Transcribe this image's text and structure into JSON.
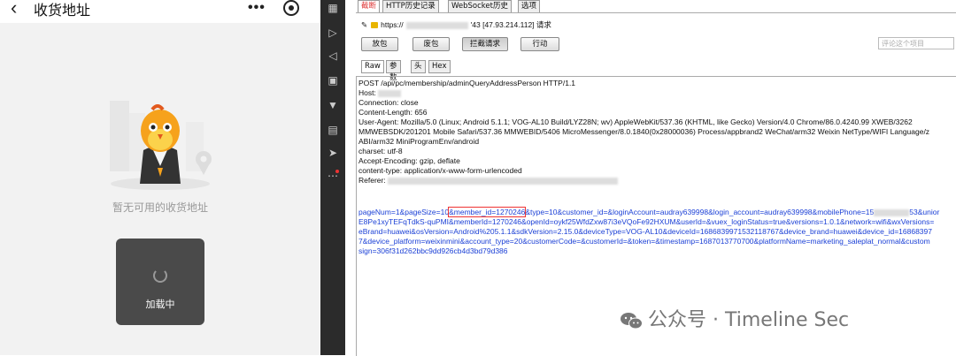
{
  "miniprogram": {
    "back_icon": "chevron-left-icon",
    "title": "收货地址",
    "more_dots": "•••",
    "empty_text": "暂无可用的收货地址",
    "loading_label": "加载中"
  },
  "burp": {
    "tabs": [
      "截断",
      "HTTP历史记录",
      "WebSocket历史",
      "选项"
    ],
    "url": {
      "prefix": "https://",
      "suffix": "'43  [47.93.214.112] 请求"
    },
    "buttons": {
      "forward": "放包",
      "drop": "废包",
      "intercept": "拦截请求",
      "action": "行动"
    },
    "search_placeholder": "评论这个项目",
    "subtabs": [
      "Raw",
      "参数",
      "头",
      "Hex"
    ],
    "request": {
      "request_line": "POST /api/pc/membership/adminQueryAddressPerson HTTP/1.1",
      "host_label": "Host:",
      "connection": "Connection: close",
      "content_length": "Content-Length: 656",
      "ua_1": "User-Agent: Mozilla/5.0 (Linux; Android 5.1.1; VOG-AL10 Build/LYZ28N; wv) AppleWebKit/537.36 (KHTML, like Gecko) Version/4.0 Chrome/86.0.4240.99 XWEB/3262",
      "ua_2": "MMWEBSDK/201201 Mobile Safari/537.36 MMWEBID/5406 MicroMessenger/8.0.1840(0x28000036) Process/appbrand2 WeChat/arm32 Weixin NetType/WIFI Language/z",
      "ua_3": "ABI/arm32 MiniProgramEnv/android",
      "charset": "charset: utf-8",
      "accept_encoding": "Accept-Encoding: gzip, deflate",
      "content_type": "content-type: application/x-www-form-urlencoded",
      "referer_label": "Referer:",
      "body_1a": "pageNum=1&pageSize=10",
      "body_1_hl": "&member_id=1270246",
      "body_1b": "&type=10&customer_id=&loginAccount=audray639998&login_account=audray639998&mobilePhone=15",
      "body_1c": "53&unior",
      "body_2": "E8Pe1xyTEFqTdkS-quPMI&memberId=1270246&openId=oykf25WfdZxw87i3eVQoFe92HXUM&userId=&vuex_loginStatus=true&versions=1.0.1&network=wifi&wxVersions=",
      "body_3": "eBrand=huawei&osVersion=Android%205.1.1&sdkVersion=2.15.0&deviceType=VOG-AL10&deviceId=1686839971532118767&device_brand=huawei&device_id=16868397",
      "body_4": "7&device_platform=weixinmini&account_type=20&customerCode=&customerId=&token=&timestamp=1687013770700&platformName=marketing_saleplat_normal&custom",
      "body_5": "sign=306f31d262bbc9dd926cb4d3bd79d386"
    }
  },
  "watermark": {
    "text": "公众号 · Timeline Sec",
    "icon": "wechat-icon"
  }
}
